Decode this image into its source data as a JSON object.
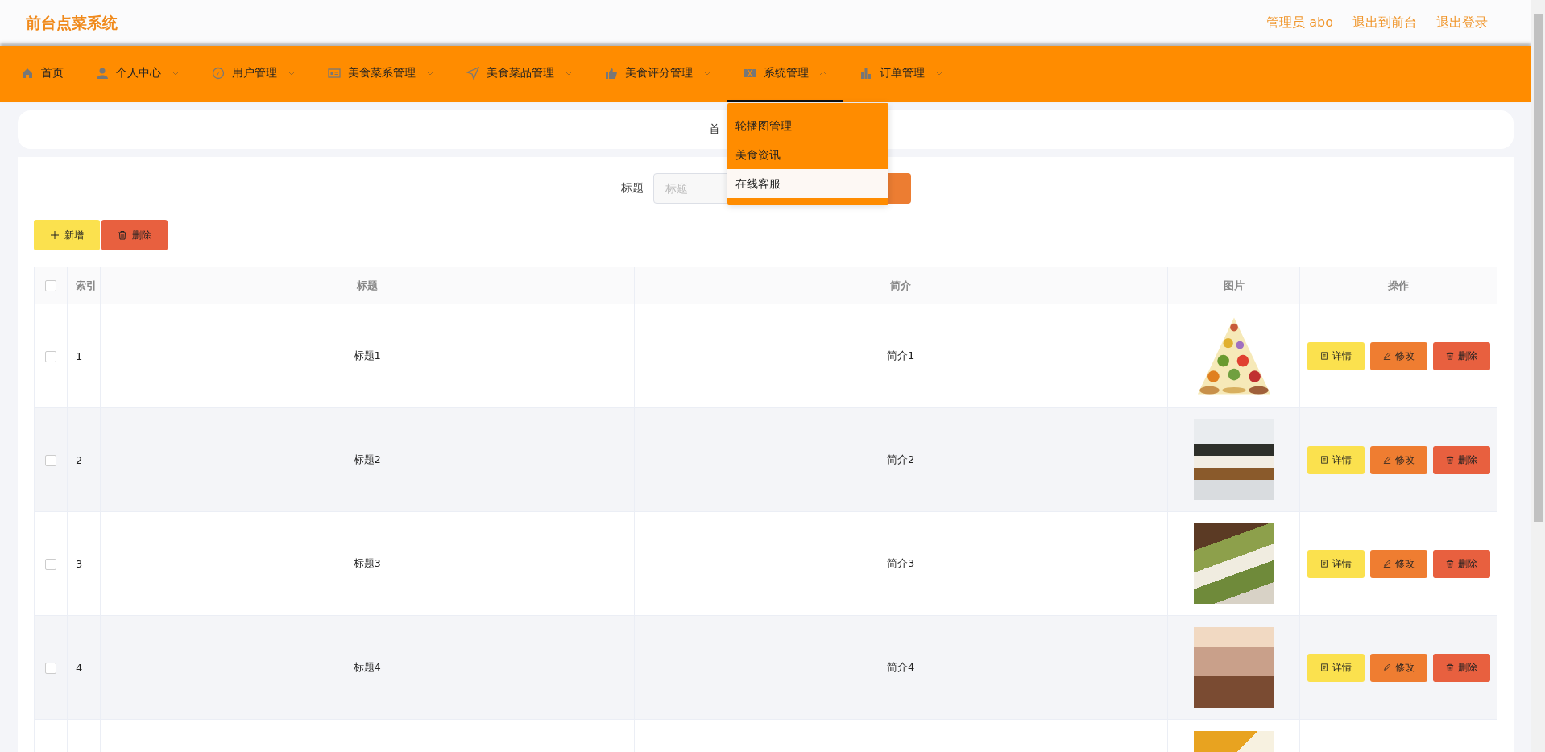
{
  "header": {
    "title": "前台点菜系统",
    "links": [
      "管理员 abo",
      "退出到前台",
      "退出登录"
    ]
  },
  "nav": [
    {
      "label": "首页",
      "kind": "link",
      "selected": false
    },
    {
      "label": "个人中心",
      "kind": "menu",
      "selected": false,
      "expanded": false
    },
    {
      "label": "用户管理",
      "kind": "menu",
      "selected": false,
      "expanded": false
    },
    {
      "label": "美食菜系管理",
      "kind": "menu",
      "selected": false,
      "expanded": false
    },
    {
      "label": "美食菜品管理",
      "kind": "menu",
      "selected": false,
      "expanded": false
    },
    {
      "label": "美食评分管理",
      "kind": "menu",
      "selected": false,
      "expanded": false
    },
    {
      "label": "系统管理",
      "kind": "menu",
      "selected": true,
      "expanded": true,
      "submenu": [
        {
          "label": "轮播图管理",
          "hovered": false
        },
        {
          "label": "美食资讯",
          "hovered": false
        },
        {
          "label": "在线客服",
          "hovered": true
        }
      ]
    },
    {
      "label": "订单管理",
      "kind": "menu",
      "selected": false,
      "expanded": false
    }
  ],
  "breadcrumb": "首",
  "search": {
    "label": "标题",
    "placeholder": "标题"
  },
  "actions": [
    {
      "label": "新增",
      "kind": "add"
    },
    {
      "label": "删除",
      "kind": "delete"
    }
  ],
  "table": {
    "select_all_checked": false,
    "columns": [
      "索引",
      "标题",
      "简介",
      "图片",
      "操作"
    ],
    "rows": [
      {
        "index": "1",
        "title": "标题1",
        "intro": "简介1",
        "checked": false,
        "buttons": [
          "详情",
          "修改",
          "删除"
        ]
      },
      {
        "index": "2",
        "title": "标题2",
        "intro": "简介2",
        "checked": false,
        "buttons": [
          "详情",
          "修改",
          "删除"
        ]
      },
      {
        "index": "3",
        "title": "标题3",
        "intro": "简介3",
        "checked": false,
        "buttons": [
          "详情",
          "修改",
          "删除"
        ]
      },
      {
        "index": "4",
        "title": "标题4",
        "intro": "简介4",
        "checked": false,
        "buttons": [
          "详情",
          "修改",
          "删除"
        ]
      }
    ]
  }
}
